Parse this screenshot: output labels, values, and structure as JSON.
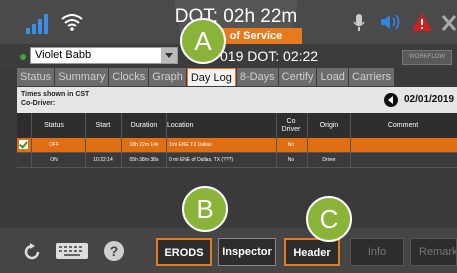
{
  "header": {
    "dot_time": "DOT: 02h 22m",
    "status": "of Service"
  },
  "driver": {
    "name": "Violet Babb",
    "dot_line": "019  DOT: 02:22",
    "workflow_label": "WORKFLOW"
  },
  "tabs": [
    "Status",
    "Summary",
    "Clocks",
    "Graph",
    "Day Log",
    "8-Days",
    "Certify",
    "Load",
    "Carriers"
  ],
  "active_tab": "Day Log",
  "info": {
    "times_shown": "Times shown in CST",
    "co_driver": "Co-Driver:",
    "date": "02/01/2019"
  },
  "table": {
    "headers": [
      "Status",
      "Start",
      "Duration",
      "Location",
      "Co Driver",
      "Origin",
      "Comment"
    ],
    "rows": [
      {
        "status": "OFF",
        "start": "",
        "duration": "18h 22m 14s",
        "location": "1mi ENE TX Dallas",
        "co_driver": "No",
        "origin": "",
        "comment": "",
        "selected": true
      },
      {
        "status": "ON",
        "start": "10:22:14",
        "duration": "05h 38m 38s",
        "location": "0 mi ENE of Dallas, TX (???)",
        "co_driver": "No",
        "origin": "Driver",
        "comment": "",
        "selected": false
      }
    ]
  },
  "buttons": {
    "erods": "ERODS",
    "inspector": "Inspector",
    "header": "Header",
    "info": "Info",
    "remarks": "Remarks",
    "help": "?"
  },
  "callouts": {
    "a": "A",
    "b": "B",
    "c": "C"
  },
  "colors": {
    "accent": "#e87a1e",
    "callout": "#8ab33a"
  }
}
